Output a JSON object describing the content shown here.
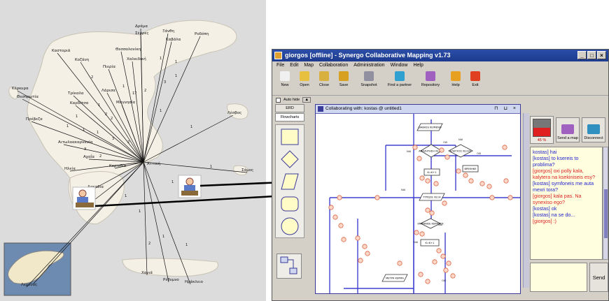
{
  "map": {
    "cities": [
      {
        "name": "Δράμα"
      },
      {
        "name": "Ξάνθη"
      },
      {
        "name": "Σέρρες"
      },
      {
        "name": "Καβάλα"
      },
      {
        "name": "Ροδόπη"
      },
      {
        "name": "Θεσσαλονίκη"
      },
      {
        "name": "Καστοριά"
      },
      {
        "name": "Χαλκιδική"
      },
      {
        "name": "Κοζάνη"
      },
      {
        "name": "Πιερία"
      },
      {
        "name": "Κέρκυρα"
      },
      {
        "name": "Θεσπρωτία"
      },
      {
        "name": "Τρίκαλα"
      },
      {
        "name": "Λάρισα"
      },
      {
        "name": "Καρδίτσα"
      },
      {
        "name": "Μαγνησία"
      },
      {
        "name": "Πρέβεζα"
      },
      {
        "name": "Λέσβος"
      },
      {
        "name": "Αιτωλοακαρνανία"
      },
      {
        "name": "Αχαΐα"
      },
      {
        "name": "Κορινθία"
      },
      {
        "name": "Αττική"
      },
      {
        "name": "Ηλεία"
      },
      {
        "name": "Αρκαδία"
      },
      {
        "name": "Σάμος"
      },
      {
        "name": "Λεμεσός"
      },
      {
        "name": "Χανιά"
      },
      {
        "name": "Ρέθυμνο"
      },
      {
        "name": "Ηράκλειο"
      }
    ],
    "edge_labels": [
      "1",
      "2",
      "1",
      "1",
      "3",
      "1",
      "1",
      "2",
      "17",
      "2",
      "2",
      "1",
      "1",
      "1",
      "1",
      "2",
      "3",
      "1",
      "1",
      "3",
      "2",
      "1",
      "1",
      "1",
      "2",
      "1",
      "1",
      "1"
    ]
  },
  "window": {
    "title": "giorgos [offline] - Synergo Collaborative Mapping v1.73",
    "controls": [
      "_",
      "□",
      "×"
    ]
  },
  "menu": [
    "File",
    "Edit",
    "Map",
    "Collaboration",
    "Administration",
    "Window",
    "Help"
  ],
  "toolbar": [
    {
      "label": "New",
      "icon": "new-doc-icon",
      "color": "#f0f0f0"
    },
    {
      "label": "Open",
      "icon": "open-folder-icon",
      "color": "#e8c040"
    },
    {
      "label": "Close",
      "icon": "close-folder-icon",
      "color": "#d8b040"
    },
    {
      "label": "Save",
      "icon": "save-icon",
      "color": "#d8a020"
    },
    {
      "label": "Snapshot",
      "icon": "camera-icon",
      "color": "#9090a0"
    },
    {
      "label": "Find a partner",
      "icon": "partner-icon",
      "color": "#30a0d0"
    },
    {
      "label": "Repository",
      "icon": "repository-icon",
      "color": "#a060c0"
    },
    {
      "label": "Help",
      "icon": "help-icon",
      "color": "#e8a020"
    },
    {
      "label": "Exit",
      "icon": "exit-icon",
      "color": "#e04020"
    }
  ],
  "subbar": {
    "autohide_label": "Auto hide"
  },
  "palette": {
    "tabs": [
      "ERD",
      "Flowcharts"
    ]
  },
  "document": {
    "title": "Collaborating with: kostas @ untitled1",
    "buttons": "⊓ ⊔ ×"
  },
  "flowchart": {
    "nodes": [
      "ΔΙΑΒΑΣΕ ΚΕΙΜΕΝΟ",
      "ΑΝΑΖΗΤΗΣΗ ΛΕΞΗΣ",
      "ΕΛΕΓΧΟΣ ΛΕΞΗΣ",
      "Κ=Κ+1",
      "ΒΡΕΘΗΚΕ",
      "ΤΥΠΩΣΕ ΛΕΞΗ",
      "ΕΜΦΑΝΙΣΕ ΚΕΡΜΑΤΑ",
      "ΜΕΤΡΑ ΚΕΡΜΑ"
    ],
    "branch_labels": [
      "NAI",
      "OXI",
      "NAI",
      "OXI",
      "NAI",
      "NAI",
      "NAI",
      "OXI"
    ]
  },
  "meter": {
    "percent_label": "45 %",
    "level": 0.45
  },
  "side_buttons": [
    {
      "label": "Send a map"
    },
    {
      "label": "Disconnect"
    }
  ],
  "chat": [
    {
      "who": "k",
      "text": "kostas] hai"
    },
    {
      "who": "k",
      "text": "[kostas] to ksereis to problima?"
    },
    {
      "who": "g",
      "text": "[giorgos] oxi polly kala, kalytera na ksekiniseis esy?"
    },
    {
      "who": "k",
      "text": "[kostas] symfoneis me auta mexri tora?"
    },
    {
      "who": "g",
      "text": "[giorgos] kala pas. Na synexiso ego?"
    },
    {
      "who": "k",
      "text": "[kostas] ok"
    },
    {
      "who": "k",
      "text": "[kostas] na se do..."
    },
    {
      "who": "g",
      "text": "[giorgos] :)"
    }
  ],
  "send_label": "Send",
  "colors": {
    "accent": "#3a3a9a",
    "link": "#4040d0",
    "node": "#e06040"
  }
}
